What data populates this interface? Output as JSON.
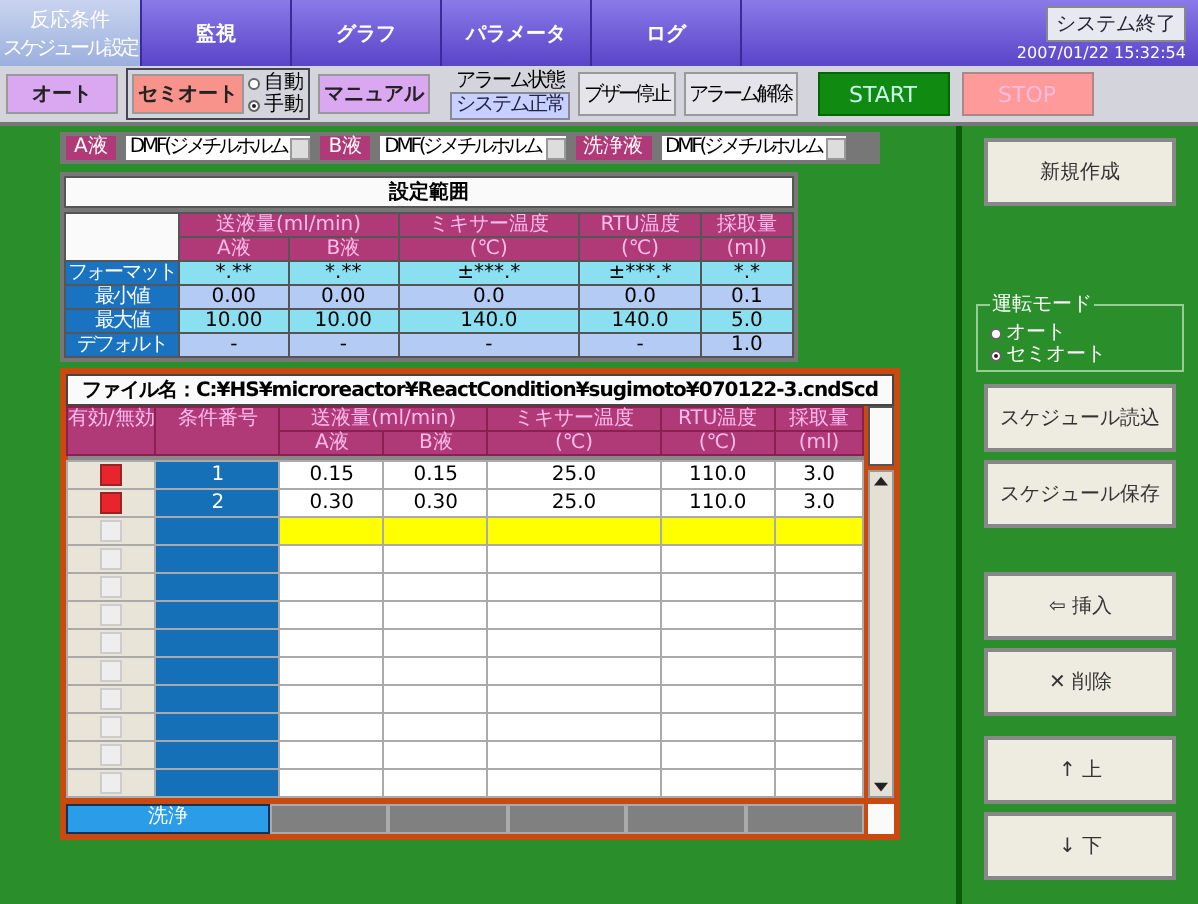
{
  "top_tabs": [
    {
      "label": "反応条件",
      "sublabel": "スケジュール設定",
      "selected": true
    },
    {
      "label": "監視",
      "selected": false
    },
    {
      "label": "グラフ",
      "selected": false
    },
    {
      "label": "パラメータ",
      "selected": false
    },
    {
      "label": "ログ",
      "selected": false
    }
  ],
  "system_exit_button": "システム終了",
  "datetime": "2007/01/22 15:32:54",
  "mode_buttons": [
    {
      "label": "オート",
      "selected": false
    },
    {
      "label": "セミオート",
      "selected": true,
      "options": [
        {
          "label": "自動",
          "selected": false
        },
        {
          "label": "手動",
          "selected": true
        }
      ]
    },
    {
      "label": "マニュアル",
      "selected": false
    }
  ],
  "alarm": {
    "label": "アラーム状態",
    "status": "システム正常"
  },
  "buzzer_stop_button": "ブザー停止",
  "alarm_reset_button": "アラーム解除",
  "start_button": {
    "label": "START",
    "disabled": false
  },
  "stop_button": {
    "label": "STOP",
    "disabled": true
  },
  "liquids": [
    {
      "label": "A液",
      "value": "DMF(ジメチルホルム"
    },
    {
      "label": "B液",
      "value": "DMF(ジメチルホルム"
    },
    {
      "label": "洗浄液",
      "value": "DMF(ジメチルホルム"
    }
  ],
  "settings": {
    "title": "設定範囲",
    "groups": [
      {
        "label": "送液量(ml/min)",
        "subs": [
          "A液",
          "B液"
        ]
      },
      {
        "label": "ミキサー温度",
        "subs": [
          "(℃)"
        ]
      },
      {
        "label": "RTU温度",
        "subs": [
          "(℃)"
        ]
      },
      {
        "label": "採取量",
        "subs": [
          "(ml)"
        ]
      }
    ],
    "rows": [
      {
        "label": "フォーマット",
        "cells": [
          "*.**",
          "*.**",
          "±***.*",
          "±***.*",
          "*.*"
        ]
      },
      {
        "label": "最小値",
        "cells": [
          "0.00",
          "0.00",
          "0.0",
          "0.0",
          "0.1"
        ]
      },
      {
        "label": "最大値",
        "cells": [
          "10.00",
          "10.00",
          "140.0",
          "140.0",
          "5.0"
        ]
      },
      {
        "label": "デフォルト",
        "cells": [
          "-",
          "-",
          "-",
          "-",
          "1.0"
        ]
      }
    ]
  },
  "schedule": {
    "file_label": "ファイル名：C:¥HS¥microreactor¥ReactCondition¥sugimoto¥070122-3.cndScd",
    "enable_header": "有効/無効",
    "number_header": "条件番号",
    "groups": [
      {
        "label": "送液量(ml/min)",
        "subs": [
          "A液",
          "B液"
        ]
      },
      {
        "label": "ミキサー温度",
        "subs": [
          "(℃)"
        ]
      },
      {
        "label": "RTU温度",
        "subs": [
          "(℃)"
        ]
      },
      {
        "label": "採取量",
        "subs": [
          "(ml)"
        ]
      }
    ],
    "rows": [
      {
        "enabled": true,
        "number": "1",
        "cells": [
          "0.15",
          "0.15",
          "25.0",
          "110.0",
          "3.0"
        ],
        "selected": false
      },
      {
        "enabled": true,
        "number": "2",
        "cells": [
          "0.30",
          "0.30",
          "25.0",
          "110.0",
          "3.0"
        ],
        "selected": false
      },
      {
        "enabled": false,
        "selected": true
      },
      {
        "enabled": false,
        "selected": false
      },
      {
        "enabled": false,
        "selected": false
      },
      {
        "enabled": false,
        "selected": false
      },
      {
        "enabled": false,
        "selected": false
      },
      {
        "enabled": false,
        "selected": false
      },
      {
        "enabled": false,
        "selected": false
      },
      {
        "enabled": false,
        "selected": false
      },
      {
        "enabled": false,
        "selected": false
      },
      {
        "enabled": false,
        "selected": false
      }
    ],
    "footer_label": "洗浄"
  },
  "new_button": "新規作成",
  "run_mode": {
    "title": "運転モード",
    "options": [
      {
        "label": "オート",
        "selected": false
      },
      {
        "label": "セミオート",
        "selected": true
      }
    ]
  },
  "side_buttons": [
    "スケジュール読込",
    "スケジュール保存"
  ],
  "edit_buttons": [
    "⇦ 挿入",
    "✕ 削除",
    "↑ 上",
    "↓ 下"
  ]
}
